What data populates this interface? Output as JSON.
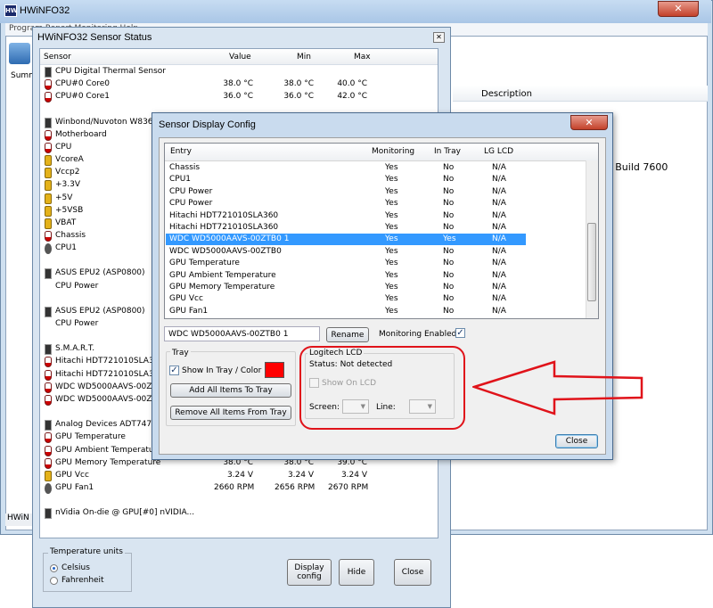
{
  "main_window": {
    "title": "HWiNFO32",
    "menu": "Program  Report  Monitoring  Help",
    "summary_label": "Summ",
    "description_header": "Description",
    "build_text": "e Build 7600",
    "status_text": "HWiN"
  },
  "sensor_window": {
    "title": "HWiNFO32 Sensor Status",
    "columns": [
      "Sensor",
      "Value",
      "Min",
      "Max"
    ],
    "rows": [
      {
        "icon": "chip",
        "name": "CPU Digital Thermal Sensor",
        "value": "",
        "min": "",
        "max": ""
      },
      {
        "icon": "therm",
        "name": "CPU#0 Core0",
        "value": "38.0 °C",
        "min": "38.0 °C",
        "max": "40.0 °C"
      },
      {
        "icon": "therm",
        "name": "CPU#0 Core1",
        "value": "36.0 °C",
        "min": "36.0 °C",
        "max": "42.0 °C"
      },
      {
        "icon": "none",
        "name": "",
        "value": "",
        "min": "",
        "max": ""
      },
      {
        "icon": "chip",
        "name": "Winbond/Nuvoton W8362",
        "value": "",
        "min": "",
        "max": ""
      },
      {
        "icon": "therm",
        "name": "Motherboard",
        "value": "",
        "min": "",
        "max": ""
      },
      {
        "icon": "therm",
        "name": "CPU",
        "value": "",
        "min": "",
        "max": ""
      },
      {
        "icon": "volt",
        "name": "VcoreA",
        "value": "",
        "min": "",
        "max": ""
      },
      {
        "icon": "volt",
        "name": "Vccp2",
        "value": "",
        "min": "",
        "max": ""
      },
      {
        "icon": "volt",
        "name": "+3.3V",
        "value": "",
        "min": "",
        "max": ""
      },
      {
        "icon": "volt",
        "name": "+5V",
        "value": "",
        "min": "",
        "max": ""
      },
      {
        "icon": "volt",
        "name": "+5VSB",
        "value": "",
        "min": "",
        "max": ""
      },
      {
        "icon": "volt",
        "name": "VBAT",
        "value": "",
        "min": "",
        "max": ""
      },
      {
        "icon": "therm",
        "name": "Chassis",
        "value": "",
        "min": "",
        "max": ""
      },
      {
        "icon": "fan",
        "name": "CPU1",
        "value": "",
        "min": "",
        "max": ""
      },
      {
        "icon": "none",
        "name": "",
        "value": "",
        "min": "",
        "max": ""
      },
      {
        "icon": "chip",
        "name": "ASUS EPU2 (ASP0800)",
        "value": "",
        "min": "",
        "max": ""
      },
      {
        "icon": "none",
        "name": "CPU Power",
        "value": "",
        "min": "",
        "max": ""
      },
      {
        "icon": "none",
        "name": "",
        "value": "",
        "min": "",
        "max": ""
      },
      {
        "icon": "chip",
        "name": "ASUS EPU2 (ASP0800)",
        "value": "",
        "min": "",
        "max": ""
      },
      {
        "icon": "none",
        "name": "CPU Power",
        "value": "",
        "min": "",
        "max": ""
      },
      {
        "icon": "none",
        "name": "",
        "value": "",
        "min": "",
        "max": ""
      },
      {
        "icon": "chip",
        "name": "S.M.A.R.T.",
        "value": "",
        "min": "",
        "max": ""
      },
      {
        "icon": "therm",
        "name": "Hitachi HDT721010SLA36",
        "value": "",
        "min": "",
        "max": ""
      },
      {
        "icon": "therm",
        "name": "Hitachi HDT721010SLA36",
        "value": "",
        "min": "",
        "max": ""
      },
      {
        "icon": "therm",
        "name": "WDC WD5000AAVS-00ZT",
        "value": "",
        "min": "",
        "max": ""
      },
      {
        "icon": "therm",
        "name": "WDC WD5000AAVS-00ZT",
        "value": "",
        "min": "",
        "max": ""
      },
      {
        "icon": "none",
        "name": "",
        "value": "",
        "min": "",
        "max": ""
      },
      {
        "icon": "chip",
        "name": "Analog Devices ADT747",
        "value": "",
        "min": "",
        "max": ""
      },
      {
        "icon": "therm",
        "name": "GPU Temperature",
        "value": "",
        "min": "",
        "max": ""
      },
      {
        "icon": "therm",
        "name": "GPU Ambient Temperature",
        "value": "",
        "min": "",
        "max": ""
      },
      {
        "icon": "therm",
        "name": "GPU Memory Temperature",
        "value": "38.0 °C",
        "min": "38.0 °C",
        "max": "39.0 °C"
      },
      {
        "icon": "volt",
        "name": "GPU Vcc",
        "value": "3.24 V",
        "min": "3.24 V",
        "max": "3.24 V"
      },
      {
        "icon": "fan",
        "name": "GPU Fan1",
        "value": "2660 RPM",
        "min": "2656 RPM",
        "max": "2670 RPM"
      },
      {
        "icon": "none",
        "name": "",
        "value": "",
        "min": "",
        "max": ""
      },
      {
        "icon": "chip",
        "name": "nVidia On-die @ GPU[#0] nVIDIA...",
        "value": "",
        "min": "",
        "max": ""
      }
    ],
    "temperature_units_label": "Temperature units",
    "celsius_label": "Celsius",
    "fahrenheit_label": "Fahrenheit",
    "display_config_label": "Display config",
    "hide_label": "Hide",
    "close_label": "Close"
  },
  "config_dialog": {
    "title": "Sensor Display Config",
    "columns": [
      "Entry",
      "Monitoring",
      "In Tray",
      "LG LCD"
    ],
    "rows": [
      {
        "entry": "Chassis",
        "monitoring": "Yes",
        "tray": "No",
        "lcd": "N/A",
        "selected": false
      },
      {
        "entry": "CPU1",
        "monitoring": "Yes",
        "tray": "No",
        "lcd": "N/A",
        "selected": false
      },
      {
        "entry": "CPU Power",
        "monitoring": "Yes",
        "tray": "No",
        "lcd": "N/A",
        "selected": false
      },
      {
        "entry": "CPU Power",
        "monitoring": "Yes",
        "tray": "No",
        "lcd": "N/A",
        "selected": false
      },
      {
        "entry": "Hitachi HDT721010SLA360",
        "monitoring": "Yes",
        "tray": "No",
        "lcd": "N/A",
        "selected": false
      },
      {
        "entry": "Hitachi HDT721010SLA360",
        "monitoring": "Yes",
        "tray": "No",
        "lcd": "N/A",
        "selected": false
      },
      {
        "entry": "WDC WD5000AAVS-00ZTB0 1",
        "monitoring": "Yes",
        "tray": "Yes",
        "lcd": "N/A",
        "selected": true
      },
      {
        "entry": "WDC WD5000AAVS-00ZTB0",
        "monitoring": "Yes",
        "tray": "No",
        "lcd": "N/A",
        "selected": false
      },
      {
        "entry": "GPU Temperature",
        "monitoring": "Yes",
        "tray": "No",
        "lcd": "N/A",
        "selected": false
      },
      {
        "entry": "GPU Ambient Temperature",
        "monitoring": "Yes",
        "tray": "No",
        "lcd": "N/A",
        "selected": false
      },
      {
        "entry": "GPU Memory Temperature",
        "monitoring": "Yes",
        "tray": "No",
        "lcd": "N/A",
        "selected": false
      },
      {
        "entry": "GPU Vcc",
        "monitoring": "Yes",
        "tray": "No",
        "lcd": "N/A",
        "selected": false
      },
      {
        "entry": "GPU Fan1",
        "monitoring": "Yes",
        "tray": "No",
        "lcd": "N/A",
        "selected": false
      }
    ],
    "name_value": "WDC WD5000AAVS-00ZTB0 1",
    "rename_label": "Rename",
    "monitoring_enabled_label": "Monitoring Enabled",
    "tray_group_label": "Tray",
    "show_in_tray_label": "Show In Tray / Color",
    "tray_color": "#ff0000",
    "add_all_label": "Add All Items To Tray",
    "remove_all_label": "Remove All Items From Tray",
    "lcd_group_label": "Logitech LCD",
    "lcd_status": "Status: Not detected",
    "show_on_lcd_label": "Show On LCD",
    "screen_label": "Screen:",
    "line_label": "Line:",
    "close_label": "Close"
  },
  "annotation": {
    "highlight_color": "#e0131a"
  }
}
